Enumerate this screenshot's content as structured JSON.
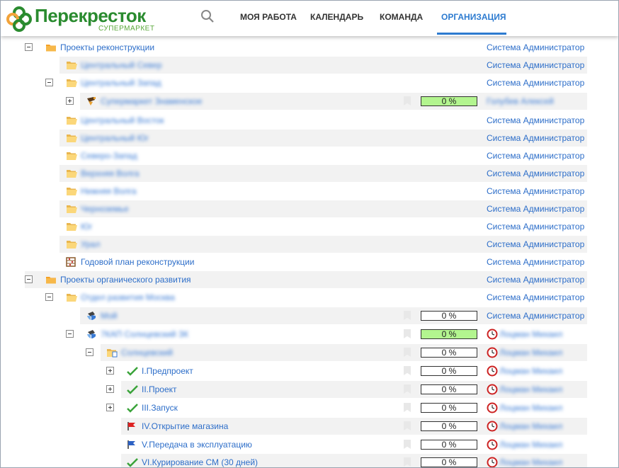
{
  "header": {
    "brand": "Перекресток",
    "brand_sub": "СУПЕРМАРКЕТ",
    "nav": [
      {
        "label": "МОЯ РАБОТА",
        "active": false
      },
      {
        "label": "КАЛЕНДАРЬ",
        "active": false
      },
      {
        "label": "КОМАНДА",
        "active": false
      },
      {
        "label": "ОРГАНИЗАЦИЯ",
        "active": true
      }
    ]
  },
  "colors": {
    "accent": "#2d7bd0",
    "brand_green": "#2a8b2f",
    "progress_green": "#b3f58f",
    "link": "#2d6ec9"
  },
  "tree": {
    "owner_admin": "Система Администратор",
    "rows": [
      {
        "label": "Проекты реконструкции",
        "icon": "folder-orange-icon",
        "toggle": "minus",
        "owner": "Система Администратор"
      },
      {
        "label": "Центральный Север",
        "icon": "folder-open-icon",
        "owner": "Система Администратор"
      },
      {
        "label": "Центральный Запад",
        "icon": "folder-open-icon",
        "toggle": "minus",
        "owner": "Система Администратор"
      },
      {
        "label": "Супермаркет Знаменское",
        "icon": "project-icon",
        "toggle": "plus",
        "progress": "0 %",
        "owner": "Голубев Алексей"
      },
      {
        "label": "Центральный Восток",
        "icon": "folder-open-icon",
        "owner": "Система Администратор"
      },
      {
        "label": "Центральный Юг",
        "icon": "folder-open-icon",
        "owner": "Система Администратор"
      },
      {
        "label": "Северо-Запад",
        "icon": "folder-open-icon",
        "owner": "Система Администратор"
      },
      {
        "label": "Верхняя Волга",
        "icon": "folder-open-icon",
        "owner": "Система Администратор"
      },
      {
        "label": "Нижняя Волга",
        "icon": "folder-open-icon",
        "owner": "Система Администратор"
      },
      {
        "label": "Черноземье",
        "icon": "folder-open-icon",
        "owner": "Система Администратор"
      },
      {
        "label": "Юг",
        "icon": "folder-open-icon",
        "owner": "Система Администратор"
      },
      {
        "label": "Урал",
        "icon": "folder-open-icon",
        "owner": "Система Администратор"
      },
      {
        "label": "Годовой план реконструкции",
        "icon": "abacus-icon",
        "owner": "Система Администратор"
      },
      {
        "label": "Проекты органического развития",
        "icon": "folder-orange-icon",
        "toggle": "minus",
        "owner": "Система Администратор"
      },
      {
        "label": "Отдел развития Москва",
        "icon": "folder-open-icon",
        "toggle": "minus",
        "owner": "Система Администратор"
      },
      {
        "label": "Мой",
        "icon": "project-shield-icon",
        "progress": "0 %",
        "owner": "Система Администратор"
      },
      {
        "label": "7КАП Солнцевский ЗК",
        "icon": "project-shield-icon",
        "toggle": "minus",
        "progress": "0 %",
        "owner": "Лоцман Михаил"
      },
      {
        "label": "Солнцевский",
        "icon": "folder-doc-icon",
        "toggle": "minus",
        "progress": "0 %",
        "owner": "Лоцман Михаил"
      },
      {
        "label": "I.Предпроект",
        "icon": "check-icon",
        "toggle": "plus",
        "progress": "0 %",
        "owner": "Лоцман Михаил"
      },
      {
        "label": "II.Проект",
        "icon": "check-icon",
        "toggle": "plus",
        "progress": "0 %",
        "owner": "Лоцман Михаил"
      },
      {
        "label": "III.Запуск",
        "icon": "check-icon",
        "toggle": "plus",
        "progress": "0 %",
        "owner": "Лоцман Михаил"
      },
      {
        "label": "IV.Открытие магазина",
        "icon": "flag-red-icon",
        "progress": "0 %",
        "owner": "Лоцман Михаил"
      },
      {
        "label": "V.Передача в эксплуатацию",
        "icon": "flag-blue-icon",
        "progress": "0 %",
        "owner": "Лоцман Михаил"
      },
      {
        "label": "VI.Курирование СМ (30 дней)",
        "icon": "check-icon",
        "progress": "0 %",
        "owner": "Лоцман Михаил"
      }
    ]
  }
}
